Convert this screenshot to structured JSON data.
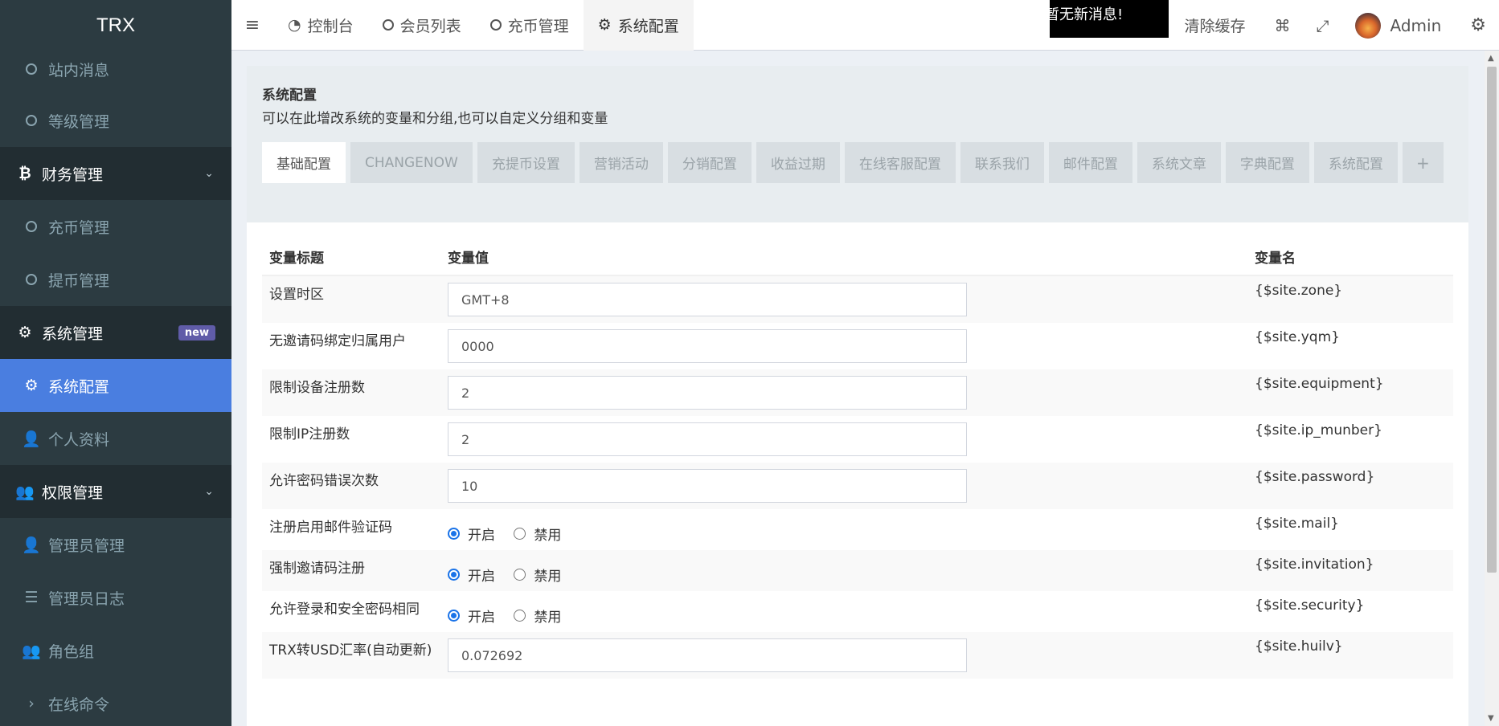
{
  "app": {
    "logo": "TRX"
  },
  "sidebar": {
    "items": [
      {
        "label": "站内消息",
        "type": "sub"
      },
      {
        "label": "等级管理",
        "type": "sub"
      },
      {
        "label": "财务管理",
        "type": "header"
      },
      {
        "label": "充币管理",
        "type": "sub"
      },
      {
        "label": "提币管理",
        "type": "sub"
      },
      {
        "label": "系统管理",
        "type": "header",
        "badge": "new"
      },
      {
        "label": "系统配置",
        "type": "active"
      },
      {
        "label": "个人资料",
        "type": "sub"
      },
      {
        "label": "权限管理",
        "type": "header"
      },
      {
        "label": "管理员管理",
        "type": "sub"
      },
      {
        "label": "管理员日志",
        "type": "sub"
      },
      {
        "label": "角色组",
        "type": "sub"
      },
      {
        "label": "在线命令",
        "type": "sub"
      }
    ]
  },
  "topbar": {
    "tabs": [
      "控制台",
      "会员列表",
      "充币管理",
      "系统配置"
    ],
    "notice": "暂无新消息!",
    "clear_cache": "清除缓存",
    "user": "Admin"
  },
  "panel": {
    "title": "系统配置",
    "subtitle": "可以在此增改系统的变量和分组,也可以自定义分组和变量",
    "tabs": [
      "基础配置",
      "CHANGENOW",
      "充提币设置",
      "营销活动",
      "分销配置",
      "收益过期",
      "在线客服配置",
      "联系我们",
      "邮件配置",
      "系统文章",
      "字典配置",
      "系统配置"
    ],
    "add_tab": "+"
  },
  "table": {
    "headers": {
      "title": "变量标题",
      "value": "变量值",
      "name": "变量名"
    },
    "rows": [
      {
        "title": "设置时区",
        "value": "GMT+8",
        "name": "{$site.zone}"
      },
      {
        "title": "无邀请码绑定归属用户",
        "value": "0000",
        "name": "{$site.yqm}"
      },
      {
        "title": "限制设备注册数",
        "value": "2",
        "name": "{$site.equipment}"
      },
      {
        "title": "限制IP注册数",
        "value": "2",
        "name": "{$site.ip_munber}"
      },
      {
        "title": "允许密码错误次数",
        "value": "10",
        "name": "{$site.password}"
      },
      {
        "title": "注册启用邮件验证码",
        "radio_on": "开启",
        "radio_off": "禁用",
        "name": "{$site.mail}"
      },
      {
        "title": "强制邀请码注册",
        "radio_on": "开启",
        "radio_off": "禁用",
        "name": "{$site.invitation}"
      },
      {
        "title": "允许登录和安全密码相同",
        "radio_on": "开启",
        "radio_off": "禁用",
        "name": "{$site.security}"
      },
      {
        "title": "TRX转USD汇率(自动更新)",
        "value": "0.072692",
        "name": "{$site.huilv}"
      }
    ]
  }
}
